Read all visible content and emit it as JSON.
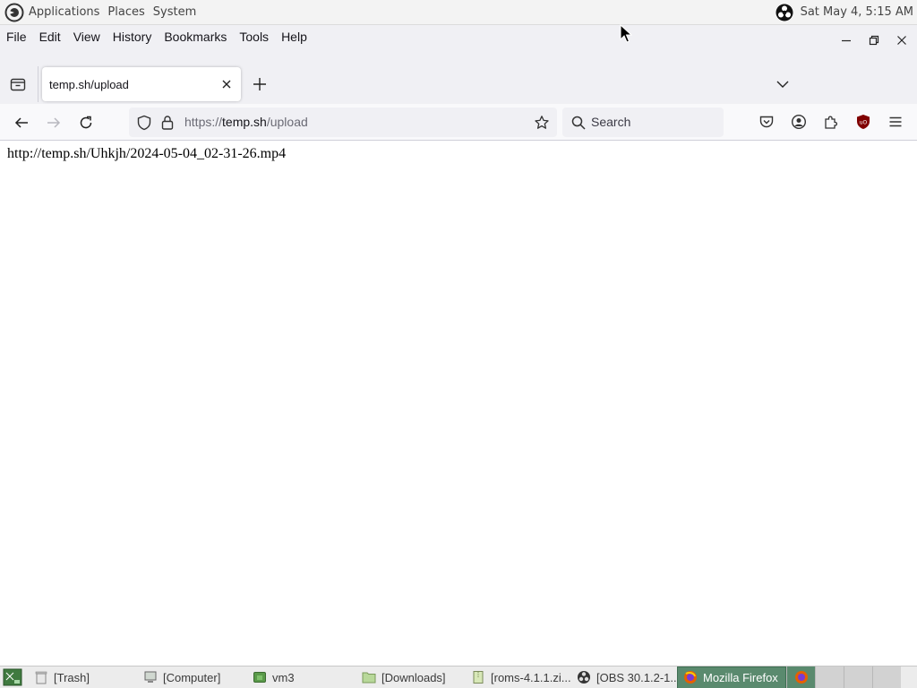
{
  "top_panel": {
    "menus": [
      "Applications",
      "Places",
      "System"
    ],
    "clock": "Sat May 4,  5:15 AM"
  },
  "browser": {
    "menubar": [
      "File",
      "Edit",
      "View",
      "History",
      "Bookmarks",
      "Tools",
      "Help"
    ],
    "tab": {
      "title": "temp.sh/upload"
    },
    "url": {
      "scheme": "https://",
      "host": "temp.sh",
      "path": "/upload"
    },
    "search_placeholder": "Search"
  },
  "page": {
    "text": "http://temp.sh/Uhkjh/2024-05-04_02-31-26.mp4"
  },
  "taskbar": {
    "tasks": [
      {
        "label": "[Trash]",
        "icon": "trash-icon"
      },
      {
        "label": "[Computer]",
        "icon": "computer-icon"
      },
      {
        "label": "vm3",
        "icon": "folder-icon"
      },
      {
        "label": "[Downloads]",
        "icon": "folder-icon"
      },
      {
        "label": "[roms-4.1.1.zi...",
        "icon": "archive-icon"
      },
      {
        "label": "[OBS 30.1.2-1...",
        "icon": "obs-icon"
      },
      {
        "label": "Mozilla Firefox",
        "icon": "firefox-icon"
      }
    ]
  },
  "colors": {
    "accent": "#5a8a6e",
    "ublock": "#800000"
  }
}
